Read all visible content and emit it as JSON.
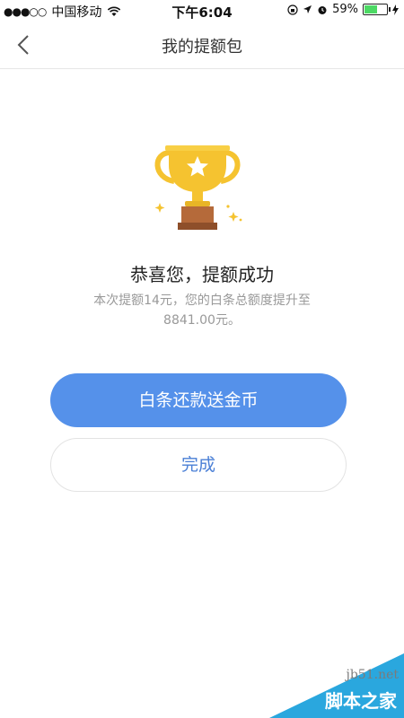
{
  "status_bar": {
    "signal": "●●●○○",
    "carrier": "中国移动",
    "time": "下午6:04",
    "battery_percent": "59%",
    "battery_level": 0.59
  },
  "nav": {
    "title": "我的提额包",
    "back_icon": "chevron-left-icon"
  },
  "result": {
    "icon": "trophy-icon",
    "title": "恭喜您，提额成功",
    "desc_line1": "本次提额14元，您的白条总额度提升至",
    "desc_line2": "8841.00元。"
  },
  "actions": {
    "primary_label": "白条还款送金币",
    "secondary_label": "完成"
  },
  "watermark": {
    "url": "jb51.net",
    "name": "脚本之家"
  },
  "colors": {
    "primary": "#5591ea",
    "secondary_text": "#4a7fd6",
    "trophy_gold": "#f5c330",
    "trophy_base": "#b56a3a"
  }
}
